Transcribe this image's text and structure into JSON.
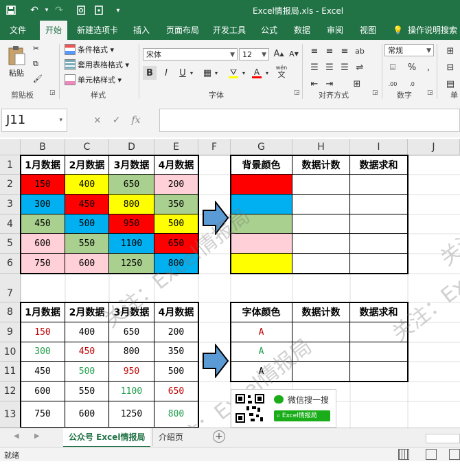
{
  "window": {
    "title": "Excel情报局.xls  -  Excel"
  },
  "quick_access": {
    "icons": [
      "save-icon",
      "undo-icon",
      "redo-icon",
      "print-preview-icon",
      "new-file-icon",
      "customize-icon"
    ]
  },
  "tabs": [
    "文件",
    "开始",
    "新建选项卡",
    "插入",
    "页面布局",
    "开发工具",
    "公式",
    "数据",
    "审阅",
    "视图"
  ],
  "active_tab_index": 1,
  "tell_me": "操作说明搜索",
  "ribbon": {
    "clipboard": {
      "label": "剪贴板",
      "paste": "粘贴"
    },
    "styles": {
      "label": "样式",
      "items": [
        "条件格式 ▾",
        "套用表格格式 ▾",
        "单元格样式 ▾"
      ]
    },
    "font": {
      "label": "字体",
      "font_name": "宋体",
      "font_size": "12",
      "bold": "B",
      "italic": "I",
      "underline": "U",
      "wen": "wén"
    },
    "align": {
      "label": "对齐方式"
    },
    "number": {
      "label": "数字",
      "format": "常规"
    },
    "cells": {
      "label": "单"
    }
  },
  "formula_bar": {
    "name_box": "J11",
    "fx": "fx",
    "cancel": "×",
    "enter": "✓",
    "value": ""
  },
  "columns": [
    "B",
    "C",
    "D",
    "E",
    "F",
    "G",
    "H",
    "I",
    "J"
  ],
  "rows": [
    "1",
    "2",
    "3",
    "4",
    "5",
    "6",
    "7",
    "8",
    "9",
    "10",
    "11",
    "12",
    "13"
  ],
  "table1": {
    "headers": [
      "1月数据",
      "2月数据",
      "3月数据",
      "4月数据"
    ],
    "rows": [
      [
        "150",
        "400",
        "650",
        "200"
      ],
      [
        "300",
        "450",
        "800",
        "350"
      ],
      [
        "450",
        "500",
        "950",
        "500"
      ],
      [
        "600",
        "550",
        "1100",
        "650"
      ],
      [
        "750",
        "600",
        "1250",
        "800"
      ]
    ],
    "bg_colors": [
      [
        "#ff0000",
        "#ffff00",
        "#a9d08e",
        "#ffd0d7"
      ],
      [
        "#00b0f0",
        "#ff0000",
        "#ffff00",
        "#a9d08e"
      ],
      [
        "#a9d08e",
        "#00b0f0",
        "#ff0000",
        "#ffff00"
      ],
      [
        "#ffd0d7",
        "#a9d08e",
        "#00b0f0",
        "#ff0000"
      ],
      [
        "#ffd0d7",
        "#ffd0d7",
        "#a9d08e",
        "#00b0f0"
      ]
    ]
  },
  "summary1": {
    "headers": [
      "背景颜色",
      "数据计数",
      "数据求和"
    ],
    "colors": [
      "#ff0000",
      "#00b0f0",
      "#a9d08e",
      "#ffd0d7",
      "#ffff00"
    ]
  },
  "table2": {
    "headers": [
      "1月数据",
      "2月数据",
      "3月数据",
      "4月数据"
    ],
    "rows": [
      [
        "150",
        "400",
        "650",
        "200"
      ],
      [
        "300",
        "450",
        "800",
        "350"
      ],
      [
        "450",
        "500",
        "950",
        "500"
      ],
      [
        "600",
        "550",
        "1100",
        "650"
      ],
      [
        "750",
        "600",
        "1250",
        "800"
      ]
    ],
    "font_colors": [
      [
        "#c00000",
        "#000000",
        "#000000",
        "#000000"
      ],
      [
        "#1e9e4a",
        "#c00000",
        "#000000",
        "#000000"
      ],
      [
        "#000000",
        "#1e9e4a",
        "#c00000",
        "#000000"
      ],
      [
        "#000000",
        "#000000",
        "#1e9e4a",
        "#c00000"
      ],
      [
        "#000000",
        "#000000",
        "#000000",
        "#1e9e4a"
      ]
    ]
  },
  "summary2": {
    "headers": [
      "字体颜色",
      "数据计数",
      "数据求和"
    ],
    "letters": [
      "A",
      "A",
      "A"
    ],
    "letter_colors": [
      "#c00000",
      "#1e9e4a",
      "#000000"
    ]
  },
  "watermarks": [
    "关注：Excel情报局",
    "关注：Excel情报局",
    "关注：Excel情报局",
    "关注：Excel情报局"
  ],
  "qr": {
    "search_label": "微信搜一搜",
    "search_button": "Excel情报局"
  },
  "sheets": [
    "公众号 Excel情报局",
    "介绍页"
  ],
  "active_sheet": 0,
  "status": {
    "ready": "就绪"
  }
}
